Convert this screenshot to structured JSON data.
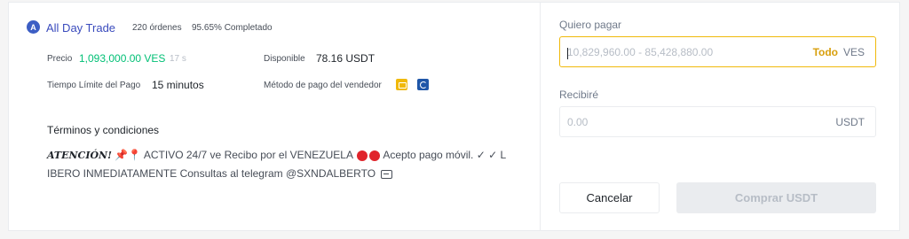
{
  "merchant": {
    "avatar_letter": "A",
    "name": "All Day Trade",
    "orders": "220 órdenes",
    "completion": "95.65% Completado"
  },
  "details": {
    "price_label": "Precio",
    "price_value": "1,093,000.00 VES",
    "price_timer": "17 s",
    "available_label": "Disponible",
    "available_value": "78.16 USDT",
    "time_limit_label": "Tiempo Límite del Pago",
    "time_limit_value": "15 minutos",
    "payment_method_label": "Método de pago del vendedor",
    "payment_icons": [
      "bank-transfer-icon",
      "mobile-payment-icon"
    ]
  },
  "terms": {
    "title": "Términos y condiciones",
    "attention": "ATENCIÓN!",
    "line1_a": "ACTIVO 24/7 ve Recibo por el VENEZUELA",
    "line1_b": "Acepto pago móvil. ✓ ✓ L",
    "line2": "IBERO INMEDIATAMENTE Consultas al telegram @SXNDALBERTO"
  },
  "order_form": {
    "pay_label": "Quiero pagar",
    "pay_placeholder": "10,829,960.00 - 85,428,880.00",
    "pay_all": "Todo",
    "pay_unit": "VES",
    "receive_label": "Recibiré",
    "receive_placeholder": "0.00",
    "receive_unit": "USDT",
    "cancel_label": "Cancelar",
    "buy_label": "Comprar USDT"
  },
  "colors": {
    "accent": "#f0b90b",
    "price_green": "#02c076",
    "merchant_blue": "#3a4bbd"
  }
}
